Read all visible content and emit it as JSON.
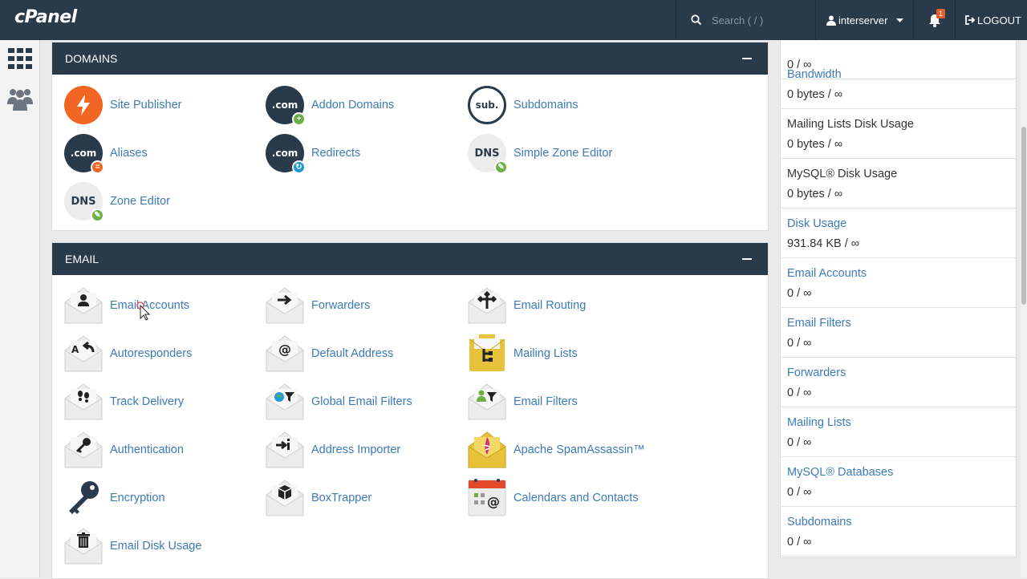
{
  "header": {
    "logo": "cPanel",
    "search_placeholder": "Search ( / )",
    "username": "interserver",
    "notification_count": "1",
    "logout_label": "LOGOUT"
  },
  "domains": {
    "title": "DOMAINS",
    "items": [
      {
        "label": "Site Publisher",
        "icon": "lightning-icon"
      },
      {
        "label": "Addon Domains",
        "icon": "dotcom-add-icon",
        "text": ".com"
      },
      {
        "label": "Subdomains",
        "icon": "sub-icon",
        "text": "sub."
      },
      {
        "label": "Aliases",
        "icon": "dotcom-alias-icon",
        "text": ".com"
      },
      {
        "label": "Redirects",
        "icon": "dotcom-redirect-icon",
        "text": ".com"
      },
      {
        "label": "Simple Zone Editor",
        "icon": "dns-edit-icon",
        "text": "DNS"
      },
      {
        "label": "Zone Editor",
        "icon": "dns-edit-icon",
        "text": "DNS"
      }
    ]
  },
  "email": {
    "title": "EMAIL",
    "items": [
      {
        "label": "Email Accounts",
        "icon": "email-accounts-icon"
      },
      {
        "label": "Forwarders",
        "icon": "forwarders-icon"
      },
      {
        "label": "Email Routing",
        "icon": "email-routing-icon"
      },
      {
        "label": "Autoresponders",
        "icon": "autoresponders-icon"
      },
      {
        "label": "Default Address",
        "icon": "default-address-icon"
      },
      {
        "label": "Mailing Lists",
        "icon": "mailing-lists-icon"
      },
      {
        "label": "Track Delivery",
        "icon": "track-delivery-icon"
      },
      {
        "label": "Global Email Filters",
        "icon": "global-filters-icon"
      },
      {
        "label": "Email Filters",
        "icon": "email-filters-icon"
      },
      {
        "label": "Authentication",
        "icon": "authentication-icon"
      },
      {
        "label": "Address Importer",
        "icon": "address-importer-icon"
      },
      {
        "label": "Apache SpamAssassin™",
        "icon": "spamassassin-icon"
      },
      {
        "label": "Encryption",
        "icon": "key-icon"
      },
      {
        "label": "BoxTrapper",
        "icon": "boxtrapper-icon"
      },
      {
        "label": "Calendars and Contacts",
        "icon": "calendar-icon"
      },
      {
        "label": "Email Disk Usage",
        "icon": "trash-icon"
      }
    ]
  },
  "stats": [
    {
      "name": "",
      "value": "0 / ∞",
      "link": false
    },
    {
      "name": "Bandwidth",
      "value": "0 bytes / ∞",
      "link": true
    },
    {
      "name": "Mailing Lists Disk Usage",
      "value": "0 bytes / ∞",
      "link": false
    },
    {
      "name": "MySQL® Disk Usage",
      "value": "0 bytes / ∞",
      "link": false
    },
    {
      "name": "Disk Usage",
      "value": "931.84 KB / ∞",
      "link": true
    },
    {
      "name": "Email Accounts",
      "value": "0 / ∞",
      "link": true
    },
    {
      "name": "Email Filters",
      "value": "0 / ∞",
      "link": true
    },
    {
      "name": "Forwarders",
      "value": "0 / ∞",
      "link": true
    },
    {
      "name": "Mailing Lists",
      "value": "0 / ∞",
      "link": true
    },
    {
      "name": "MySQL® Databases",
      "value": "0 / ∞",
      "link": true
    },
    {
      "name": "Subdomains",
      "value": "0 / ∞",
      "link": true
    }
  ]
}
